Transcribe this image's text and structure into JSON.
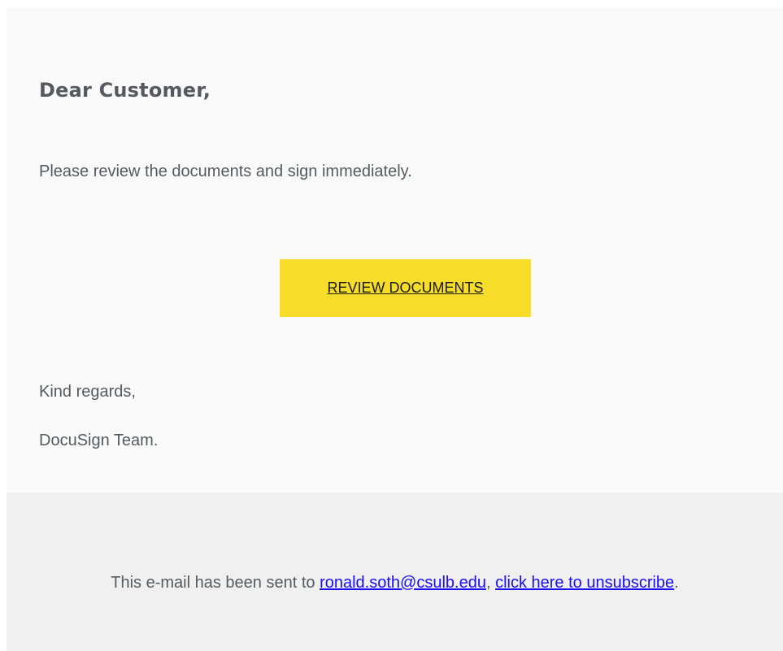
{
  "email": {
    "greeting": "Dear Customer,",
    "message": "Please review the documents and sign immediately.",
    "cta_label": "REVIEW DOCUMENTS",
    "signoff": "Kind regards,",
    "signature": "DocuSign Team."
  },
  "footer": {
    "prefix": "This e-mail has been sent to ",
    "recipient_email": "ronald.soth@csulb.edu",
    "separator": ", ",
    "unsubscribe_label": "click here to unsubscribe",
    "suffix": "."
  },
  "colors": {
    "main_background": "#fafafa",
    "footer_background": "#f0f0f0",
    "button_background": "#f7dd2a",
    "text": "#555a61",
    "link": "#1a0dff"
  }
}
